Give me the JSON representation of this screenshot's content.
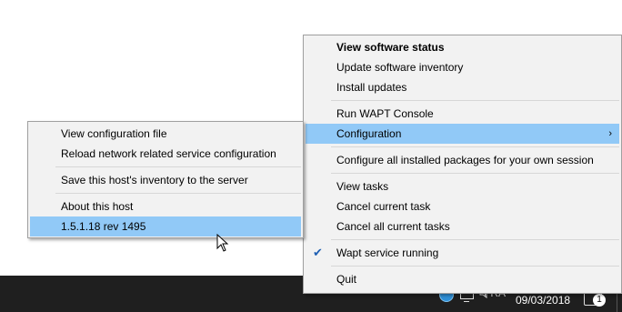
{
  "main_menu": {
    "status": "View software status",
    "update_inventory": "Update software inventory",
    "install_updates": "Install updates",
    "run_console": "Run WAPT Console",
    "configuration": "Configuration",
    "configure_packages": "Configure all installed packages for your own session",
    "view_tasks": "View tasks",
    "cancel_current": "Cancel current task",
    "cancel_all": "Cancel all current tasks",
    "service_running": "Wapt service running",
    "quit": "Quit"
  },
  "sub_menu": {
    "view_config": "View configuration file",
    "reload_network": "Reload network related service configuration",
    "save_inventory": "Save this host's inventory to the server",
    "about_host": "About this host",
    "version": "1.5.1.18 rev 1495"
  },
  "taskbar": {
    "language": "FRA",
    "date": "09/03/2018",
    "notification_count": "1"
  },
  "colors": {
    "menu_background": "#f2f2f2",
    "highlight": "#91c9f7",
    "taskbar": "#1f1f1f"
  }
}
